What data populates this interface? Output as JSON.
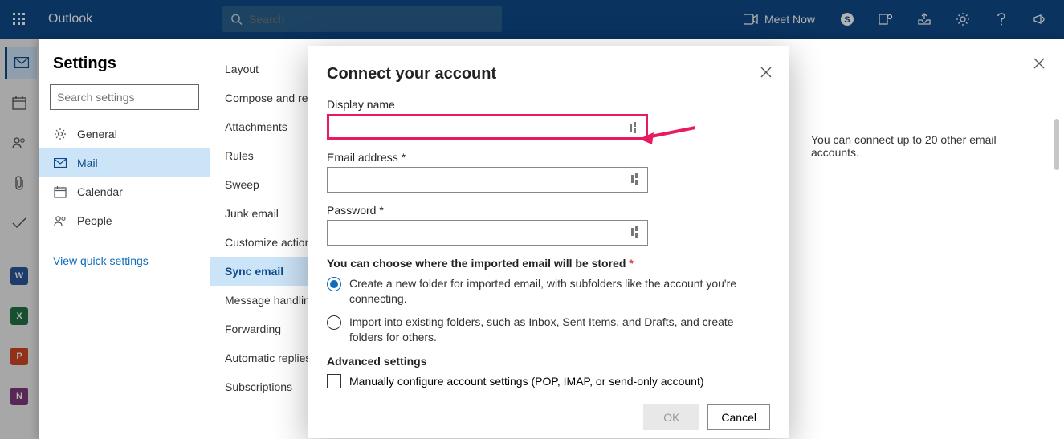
{
  "topbar": {
    "app_title": "Outlook",
    "search_placeholder": "Search",
    "meet_now": "Meet Now"
  },
  "leftrail": {
    "apps": [
      "W",
      "X",
      "P",
      "N"
    ]
  },
  "settings": {
    "title": "Settings",
    "search_placeholder": "Search settings",
    "categories": {
      "general": "General",
      "mail": "Mail",
      "calendar": "Calendar",
      "people": "People"
    },
    "view_quick": "View quick settings",
    "subnav": {
      "layout": "Layout",
      "compose": "Compose and reply",
      "attachments": "Attachments",
      "rules": "Rules",
      "sweep": "Sweep",
      "junk": "Junk email",
      "customize": "Customize actions",
      "sync": "Sync email",
      "message_handling": "Message handling",
      "forwarding": "Forwarding",
      "auto_replies": "Automatic replies",
      "subscriptions": "Subscriptions"
    },
    "sync_email_desc": "You can connect up to 20 other email accounts."
  },
  "modal": {
    "title": "Connect your account",
    "display_name_label": "Display name",
    "email_label": "Email address *",
    "password_label": "Password *",
    "store_label_pre": "You can choose where the imported email will be stored",
    "store_label_ast": "*",
    "opt_new_folder": "Create a new folder for imported email, with subfolders like the account you're connecting.",
    "opt_existing": "Import into existing folders, such as Inbox, Sent Items, and Drafts, and create folders for others.",
    "advanced_label": "Advanced settings",
    "manual_config": "Manually configure account settings (POP, IMAP, or send-only account)",
    "ok": "OK",
    "cancel": "Cancel",
    "display_name_value": "",
    "email_value": "",
    "password_value": ""
  }
}
